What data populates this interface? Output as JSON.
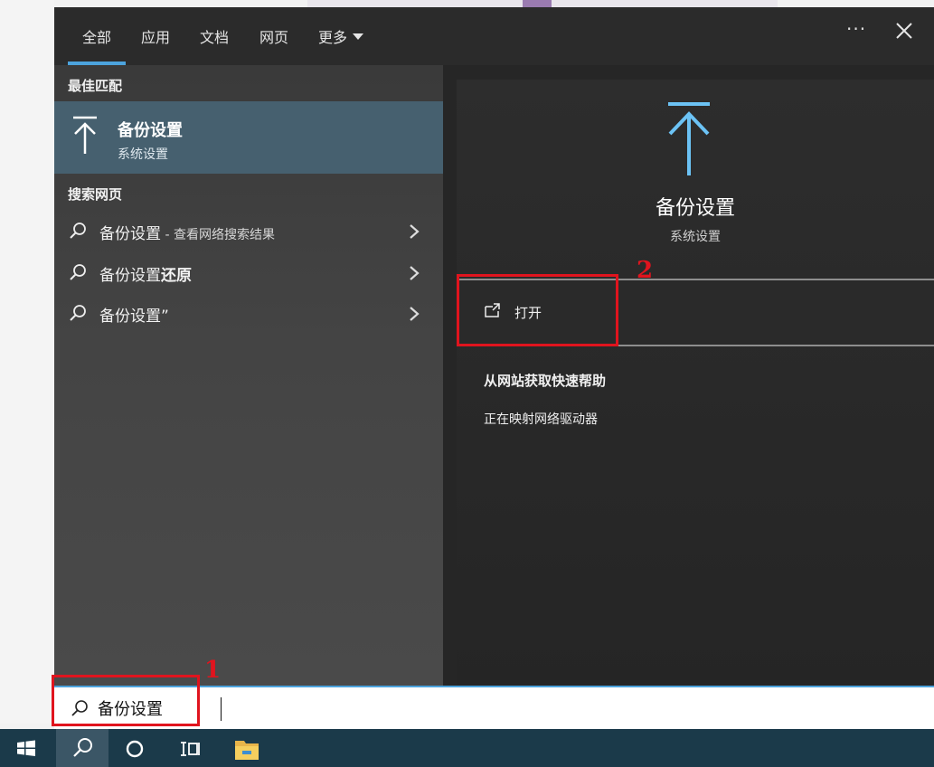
{
  "tabs": {
    "all": "全部",
    "apps": "应用",
    "docs": "文档",
    "web": "网页",
    "more": "更多"
  },
  "left": {
    "best_match_header": "最佳匹配",
    "best_match": {
      "title": "备份设置",
      "subtitle": "系统设置",
      "icon": "backup-upload-icon"
    },
    "web_header": "搜索网页",
    "web_results": [
      {
        "main": "备份设置",
        "suffix": " - 查看网络搜索结果"
      },
      {
        "main": "备份设置",
        "bold": "还原"
      },
      {
        "main": "备份设置”"
      }
    ]
  },
  "detail": {
    "title": "备份设置",
    "subtitle": "系统设置",
    "open_label": "打开",
    "help_title": "从网站获取快速帮助",
    "help_link": "正在映射网络驱动器"
  },
  "search": {
    "value": "备份设置"
  },
  "annotations": {
    "one": "1",
    "two": "2"
  },
  "colors": {
    "accent": "#4ca3dd",
    "best_match_bg": "#46606f",
    "highlight": "#e0141e",
    "taskbar": "#1b3a4a"
  }
}
